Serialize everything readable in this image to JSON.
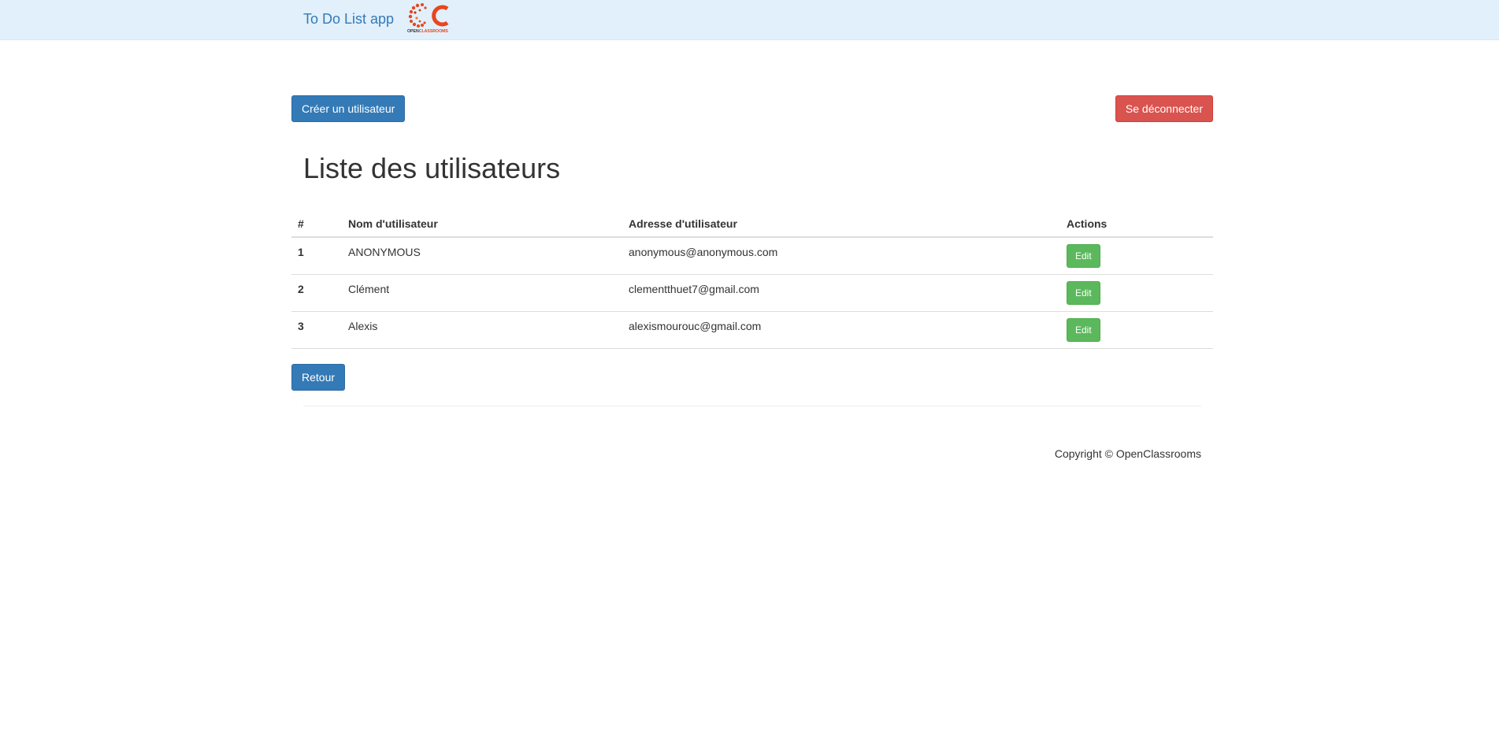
{
  "navbar": {
    "brand": "To Do List app",
    "logo_icon": "openclassrooms-logo-icon",
    "logo_caption": "OPENCLASSROOMS"
  },
  "actions": {
    "create_user": "Créer un utilisateur",
    "logout": "Se déconnecter"
  },
  "page": {
    "title": "Liste des utilisateurs"
  },
  "table": {
    "headers": [
      "#",
      "Nom d'utilisateur",
      "Adresse d'utilisateur",
      "Actions"
    ],
    "rows": [
      {
        "id": "1",
        "username": "ANONYMOUS",
        "email": "anonymous@anonymous.com",
        "action": "Edit"
      },
      {
        "id": "2",
        "username": "Clément",
        "email": "clementthuet7@gmail.com",
        "action": "Edit"
      },
      {
        "id": "3",
        "username": "Alexis",
        "email": "alexismourouc@gmail.com",
        "action": "Edit"
      }
    ]
  },
  "back": "Retour",
  "footer": {
    "copyright": "Copyright © OpenClassrooms"
  },
  "colors": {
    "navbar_bg": "#e1f0fb",
    "primary": "#337ab7",
    "danger": "#d9534f",
    "success": "#5cb85c",
    "logo": "#e8461e"
  }
}
